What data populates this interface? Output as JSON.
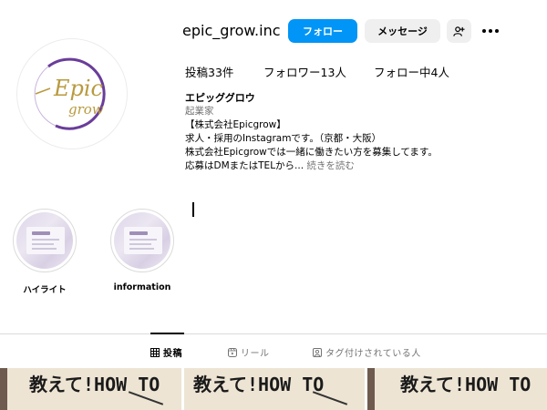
{
  "profile": {
    "username": "epic_grow.inc",
    "avatar": {
      "logo_line1": "Epic",
      "logo_line2": "grow"
    },
    "buttons": {
      "follow": "フォロー",
      "message": "メッセージ"
    },
    "stats": {
      "posts": "投稿33件",
      "followers": "フォロワー13人",
      "following": "フォロー中4人"
    },
    "bio": {
      "name": "エピッググロウ",
      "category": "起業家",
      "lines": [
        "【株式会社Epicgrow】",
        "求人・採用のInstagramです。（京都・大阪）",
        "株式会社Epicgrowでは一緒に働きたい方を募集してます。"
      ],
      "last_line": "応募はDMまたはTELから...",
      "more": "続きを読む"
    }
  },
  "highlights": [
    {
      "label": "ハイライト"
    },
    {
      "label": "information"
    }
  ],
  "tabs": [
    {
      "label": "投稿",
      "active": true
    },
    {
      "label": "リール",
      "active": false
    },
    {
      "label": "タグ付けされている人",
      "active": false
    }
  ],
  "posts": [
    {
      "text": "教えて!HOW TO"
    },
    {
      "text": "教えて!HOW TO"
    },
    {
      "text": "教えて!HOW TO"
    }
  ],
  "colors": {
    "accent": "#0095f6",
    "secondary_button": "#efefef",
    "muted_text": "#737373",
    "logo_gold": "#b89a3e",
    "logo_purple": "#6a3d9a"
  }
}
